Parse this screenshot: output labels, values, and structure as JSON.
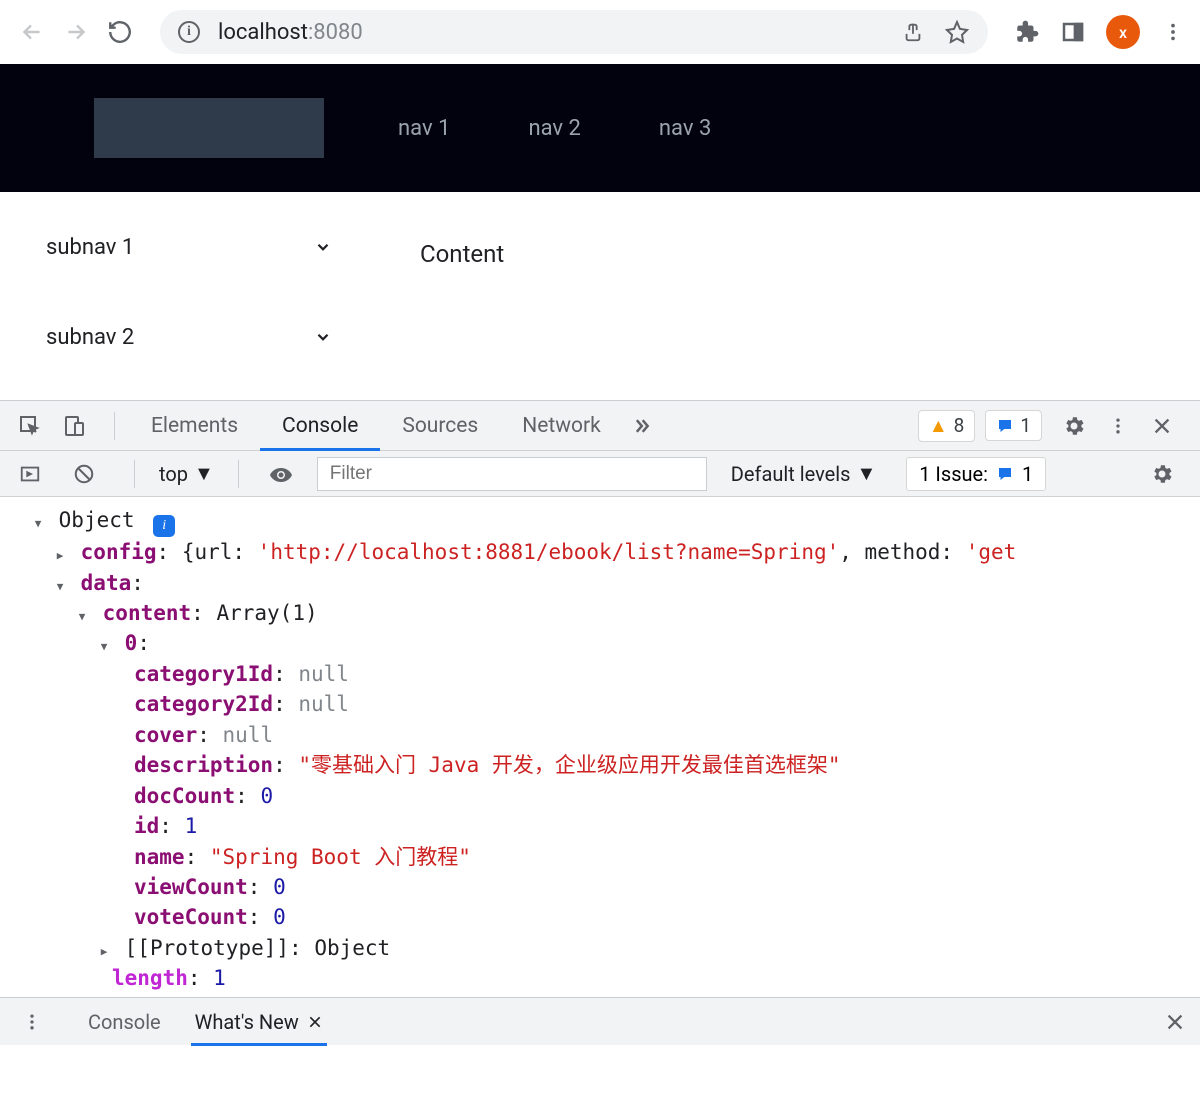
{
  "browser": {
    "url_host": "localhost",
    "url_port": ":8080",
    "avatar_letter": "x"
  },
  "page": {
    "nav": [
      "nav 1",
      "nav 2",
      "nav 3"
    ],
    "subnav": [
      "subnav 1",
      "subnav 2"
    ],
    "content": "Content"
  },
  "devtools": {
    "tabs": {
      "elements": "Elements",
      "console": "Console",
      "sources": "Sources",
      "network": "Network"
    },
    "warn_count": "8",
    "msg_count": "1",
    "context": "top",
    "filter_placeholder": "Filter",
    "levels": "Default levels",
    "issue_label": "1 Issue:",
    "issue_count": "1",
    "drawer": {
      "console": "Console",
      "whatsnew": "What's New"
    }
  },
  "console": {
    "object_label": "Object",
    "config_key": "config",
    "config_value_prefix": "{url: ",
    "config_url": "'http://localhost:8881/ebook/list?name=Spring'",
    "config_value_mid": ", method: ",
    "config_method": "'get",
    "data_key": "data",
    "content_key": "content",
    "content_value": "Array(1)",
    "idx0": "0",
    "fields": {
      "category1Id_key": "category1Id",
      "category1Id_val": "null",
      "category2Id_key": "category2Id",
      "category2Id_val": "null",
      "cover_key": "cover",
      "cover_val": "null",
      "description_key": "description",
      "description_val": "\"零基础入门 Java 开发，企业级应用开发最佳首选框架\"",
      "docCount_key": "docCount",
      "docCount_val": "0",
      "id_key": "id",
      "id_val": "1",
      "name_key": "name",
      "name_val": "\"Spring Boot 入门教程\"",
      "viewCount_key": "viewCount",
      "viewCount_val": "0",
      "voteCount_key": "voteCount",
      "voteCount_val": "0"
    },
    "prototype_key": "[[Prototype]]",
    "prototype_val": "Object",
    "length_key": "length",
    "length_val": "1"
  }
}
